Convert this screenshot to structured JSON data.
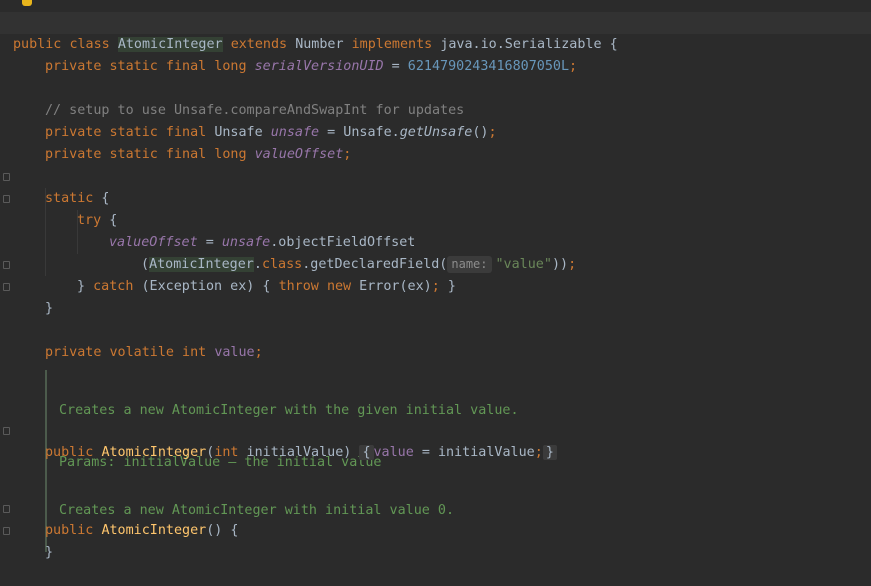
{
  "colors": {
    "background": "#2b2b2b",
    "keyword": "#cc7832",
    "field": "#9876aa",
    "number": "#6897bb",
    "string": "#6a8759",
    "method_decl": "#ffc66d",
    "comment": "#808080",
    "doc_comment": "#629755",
    "text": "#a9b7c6"
  },
  "icons": {
    "intention_bulb": "lightbulb-icon",
    "fold": "fold-marker-icon"
  },
  "code": {
    "l1": {
      "public": "public",
      "class": "class",
      "name": "AtomicInteger",
      "extends": "extends",
      "number": "Number",
      "implements": "implements",
      "iface": "java.io.Serializable",
      "brace": " {"
    },
    "l2": {
      "mods": "private static final long ",
      "field": "serialVersionUID",
      "eq": " = ",
      "num": "6214790243416807050L",
      "semi": ";"
    },
    "l3": {
      "comment": "// setup to use Unsafe.compareAndSwapInt for updates"
    },
    "l4": {
      "mods": "private static final ",
      "type": "Unsafe ",
      "field": "unsafe",
      "eq": " = Unsafe.",
      "call": "getUnsafe",
      "rest": "()",
      "semi": ";"
    },
    "l5": {
      "mods": "private static final long ",
      "field": "valueOffset",
      "semi": ";"
    },
    "l6": {
      "static": "static",
      "brace": " {"
    },
    "l7": {
      "try": "try",
      "brace": " {"
    },
    "l8": {
      "field": "valueOffset",
      "eq": " = ",
      "obj": "unsafe",
      "call": ".objectFieldOffset"
    },
    "l9": {
      "open": "(",
      "cls": "AtomicInteger",
      "dotclass": ".",
      "classkw": "class",
      "call": ".getDeclaredField(",
      "hint": "name:",
      "str": "\"value\"",
      "close": "))",
      "semi": ";"
    },
    "l10": {
      "close1": "} ",
      "catch": "catch",
      "mid": " (Exception ex) { ",
      "throw": "throw",
      "sp": " ",
      "new": "new",
      "rest": " Error(ex)",
      "semi": ";",
      "close2": " }"
    },
    "l11": {
      "close": "}"
    },
    "l12": {
      "mods": "private volatile int ",
      "field": "value",
      "semi": ";"
    },
    "doc1": {
      "line1": "Creates a new AtomicInteger with the given initial value.",
      "params_label": "Params:",
      "params_text": " initialValue – the initial value"
    },
    "l13": {
      "public": "public ",
      "name": "AtomicInteger",
      "open": "(",
      "int": "int",
      "param": " initialValue)",
      "sp": " ",
      "ob": "{",
      "field": "value",
      "assign": " = initialValue",
      "semi": ";",
      "cb": "}"
    },
    "doc2": {
      "line1": "Creates a new AtomicInteger with initial value 0."
    },
    "l14": {
      "public": "public ",
      "name": "AtomicInteger",
      "rest": "() {"
    },
    "l15": {
      "close": "}"
    }
  }
}
